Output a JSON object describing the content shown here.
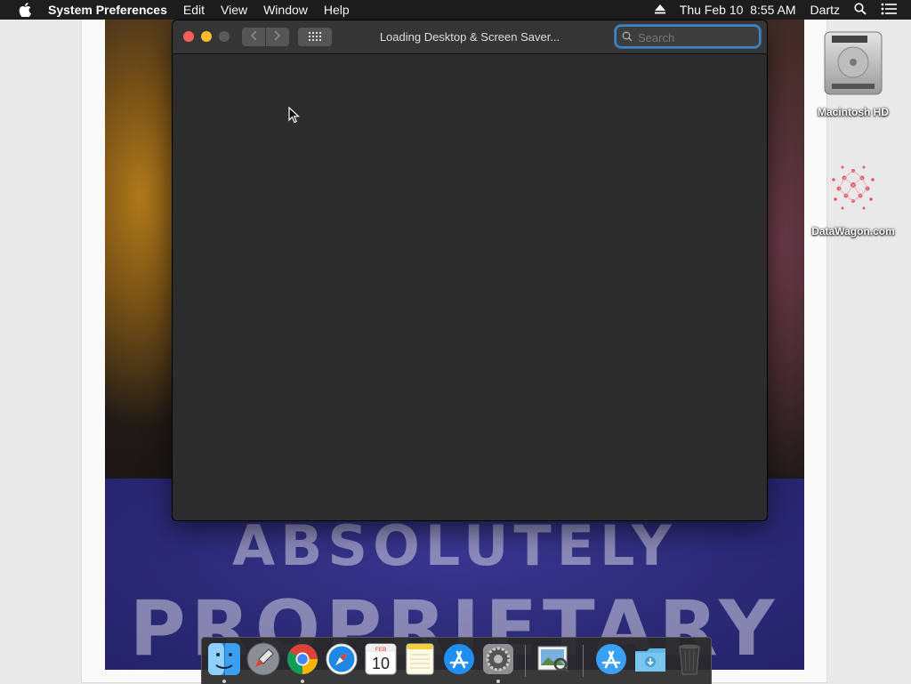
{
  "menubar": {
    "app_name": "System Preferences",
    "menus": [
      "Edit",
      "View",
      "Window",
      "Help"
    ],
    "clock": "Thu Feb 10  8:55 AM",
    "user": "Dartz"
  },
  "window": {
    "title": "Loading Desktop & Screen Saver...",
    "search_placeholder": "Search"
  },
  "desktop_icons": [
    {
      "label": "Macintosh HD",
      "icon": "hard-drive-icon"
    },
    {
      "label": "DataWagon.com",
      "icon": "datawagon-icon"
    }
  ],
  "wallpaper": {
    "line1": "ABSOLUTELY",
    "line2": "PROPRIETARY"
  },
  "dock": {
    "calendar": {
      "month": "FEB",
      "day": "10"
    },
    "items": [
      "finder",
      "launchpad",
      "chrome",
      "safari",
      "calendar",
      "notes",
      "app-store",
      "system-preferences",
      "preview",
      "app-store-folder",
      "downloads-folder",
      "trash"
    ]
  },
  "colors": {
    "close": "#ff5f57",
    "minimize": "#febc2e",
    "search_focus": "#3a86c8"
  }
}
